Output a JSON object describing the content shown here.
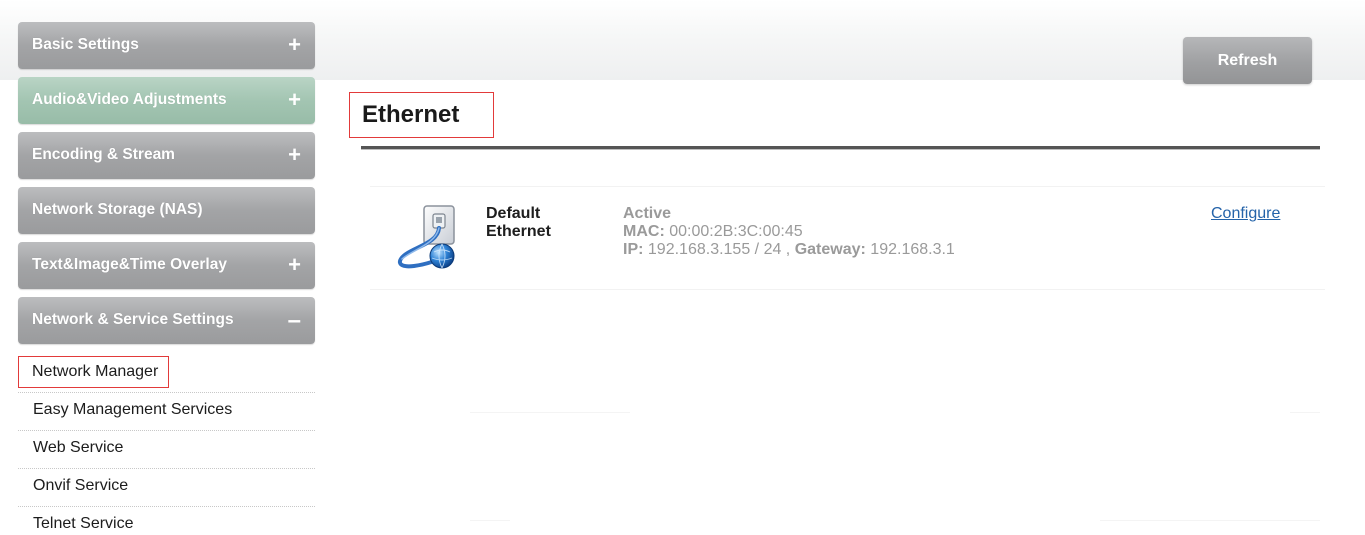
{
  "sidebar": {
    "menus": [
      {
        "label": "Basic Settings",
        "toggle": "+"
      },
      {
        "label": "Audio&Video Adjustments",
        "toggle": "+"
      },
      {
        "label": "Encoding & Stream",
        "toggle": "+"
      },
      {
        "label": "Network Storage (NAS)",
        "toggle": ""
      },
      {
        "label": "Text&Image&Time Overlay",
        "toggle": "+"
      },
      {
        "label": "Network & Service Settings",
        "toggle": "–"
      }
    ],
    "submenu": [
      {
        "label": "Network Manager",
        "selected": true
      },
      {
        "label": "Easy Management Services"
      },
      {
        "label": "Web Service"
      },
      {
        "label": "Onvif Service"
      },
      {
        "label": "Telnet Service"
      }
    ]
  },
  "toolbar": {
    "refresh_label": "Refresh"
  },
  "main": {
    "title": "Ethernet",
    "connection": {
      "name_line1": "Default",
      "name_line2": "Ethernet",
      "status": "Active",
      "mac_label": "MAC:",
      "mac_value": "00:00:2B:3C:00:45",
      "ip_label": "IP:",
      "ip_value": "192.168.3.155 / 24 ,",
      "gateway_label": "Gateway:",
      "gateway_value": "192.168.3.1",
      "configure_label": "Configure",
      "icon": "ethernet-globe-icon"
    }
  },
  "colors": {
    "menu_gray": "#a3a4a6",
    "menu_green": "#a3c5b2",
    "highlight_red": "#e23a3a",
    "link_blue": "#2463a9"
  }
}
